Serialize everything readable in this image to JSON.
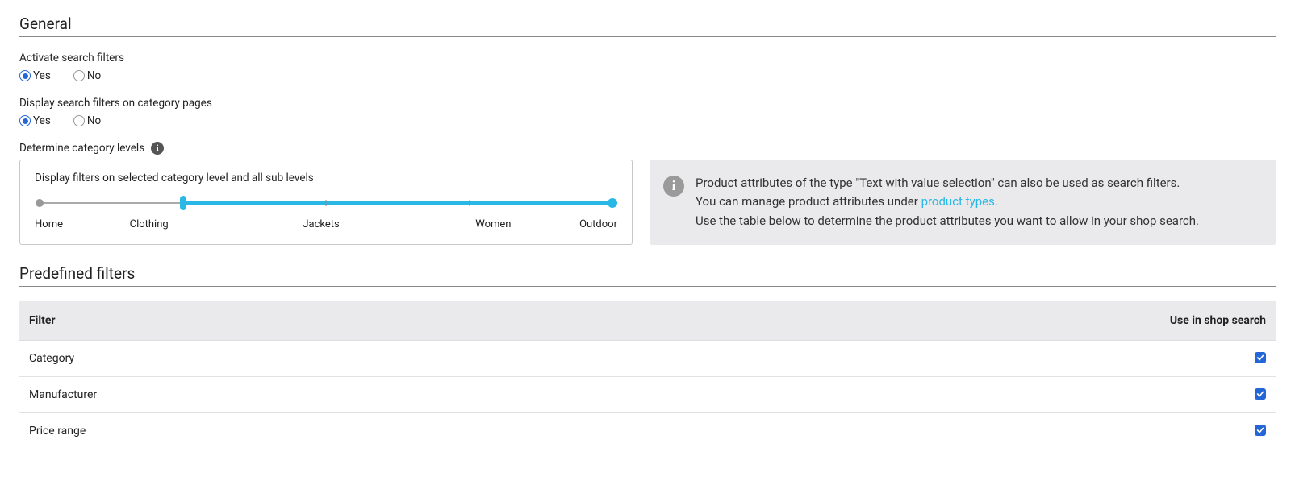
{
  "sections": {
    "general": "General",
    "predefined": "Predefined filters"
  },
  "activate": {
    "label": "Activate search filters",
    "yes": "Yes",
    "no": "No",
    "value": "yes"
  },
  "display_category": {
    "label": "Display search filters on category pages",
    "yes": "Yes",
    "no": "No",
    "value": "yes"
  },
  "levels": {
    "label": "Determine category levels",
    "caption": "Display filters on selected category level and all sub levels",
    "stops": [
      "Home",
      "Clothing",
      "Jackets",
      "Women",
      "Outdoor"
    ],
    "selected_from_index": 1,
    "selected_to_index": 4
  },
  "info": {
    "line1_a": "Product attributes of the type \"Text with value selection\" can also be used as search filters.",
    "line2_a": "You can manage product attributes under ",
    "line2_link": "product types",
    "line2_b": ".",
    "line3": "Use the table below to determine the product attributes you want to allow in your shop search."
  },
  "table": {
    "head_filter": "Filter",
    "head_use": "Use in shop search",
    "rows": [
      {
        "name": "Category",
        "checked": true
      },
      {
        "name": "Manufacturer",
        "checked": true
      },
      {
        "name": "Price range",
        "checked": true
      }
    ]
  }
}
